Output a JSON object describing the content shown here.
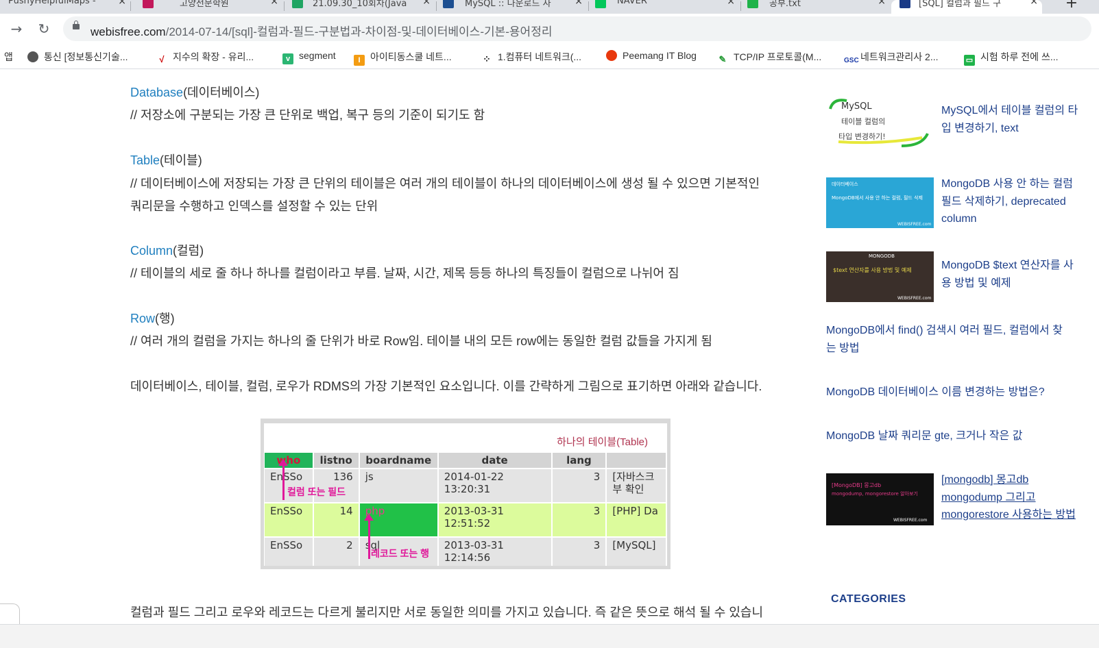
{
  "tabs": [
    {
      "label": "PushyHelpfulMaps - ",
      "close": "×"
    },
    {
      "label": "고양전문학원",
      "close": "×"
    },
    {
      "label": "21.09.30_10회차(Java",
      "close": "×"
    },
    {
      "label": "MySQL :: 다운로드 사",
      "close": "×"
    },
    {
      "label": "NAVER",
      "close": "×"
    },
    {
      "label": "공부.txt",
      "close": "×"
    },
    {
      "label": "[SQL] 컬럼과 필드 구",
      "close": "×"
    }
  ],
  "new_tab": "+",
  "nav": {
    "back": "→",
    "reload": "↻"
  },
  "url": {
    "host": "webisfree.com",
    "path": "/2014-07-14/[sql]-컬럼과-필드-구분법과-차이점-및-데이터베이스-기본-용어정리"
  },
  "bookmarks": [
    {
      "label": "앱",
      "icon": "apps-icon"
    },
    {
      "label": "통신 [정보통신기술...",
      "icon": "globe-icon"
    },
    {
      "label": "지수의 확장 - 유리...",
      "icon": "math-icon"
    },
    {
      "label": "segment",
      "icon": "v-icon"
    },
    {
      "label": "아이티동스쿨 네트...",
      "icon": "school-icon"
    },
    {
      "label": "1.컴퓨터 네트워크(...",
      "icon": "dots-icon"
    },
    {
      "label": "Peemang IT Blog",
      "icon": "blog-icon"
    },
    {
      "label": "TCP/IP 프로토콜(M...",
      "icon": "pen-icon"
    },
    {
      "label": "네트워크관리사 2...",
      "icon": "gsc-icon"
    },
    {
      "label": "시험 하루 전에 쓰...",
      "icon": "chat-icon"
    }
  ],
  "article": {
    "database": {
      "kw": "Database",
      "ko": "(데이터베이스)",
      "desc": "// 저장소에 구분되는 가장 큰 단위로 백업, 복구 등의 기준이 되기도 함"
    },
    "table": {
      "kw": "Table",
      "ko": "(테이블)",
      "desc1": "// 데이터베이스에 저장되는 가장 큰 단위의 테이블은 여러 개의 테이블이 하나의 데이터베이스에 생성 될 수 있으면 기본적인",
      "desc2": "쿼리문을 수행하고 인덱스를 설정할 수 있는 단위"
    },
    "column": {
      "kw": "Column",
      "ko": "(컬럼)",
      "desc": "// 테이블의 세로 줄 하나 하나를 컬럼이라고 부름. 날짜, 시간, 제목 등등 하나의 특징들이 컬럼으로 나뉘어 짐"
    },
    "row": {
      "kw": "Row",
      "ko": "(행)",
      "desc": "// 여러 개의 컬럼을 가지는 하나의 줄 단위가 바로 Row임. 테이블 내의 모든 row에는  동일한 컬럼 값들을 가지게 됨"
    },
    "summary": "데이터베이스, 테이블, 컬럼, 로우가 RDMS의 가장 기본적인 요소입니다. 이를 간략하게 그림으로 표기하면 아래와 같습니다.",
    "bottom": "컬럼과 필드 그리고 로우와 레코드는 다르게 불리지만 서로 동일한 의미를 가지고 있습니다. 즉 같은 뜻으로 해석 될 수 있습니"
  },
  "figure": {
    "title": "하나의 테이블(Table)",
    "headers": [
      "who",
      "listno",
      "boardname",
      "date",
      "lang",
      ""
    ],
    "rows": [
      [
        "EnSSo",
        "136",
        "js",
        "2014-01-22 13:20:31",
        "3",
        "[자바스크",
        "부 확인"
      ],
      [
        "EnSSo",
        "14",
        "php",
        "2013-03-31 12:51:52",
        "3",
        "[PHP] Da",
        ""
      ],
      [
        "EnSSo",
        "2",
        "sql",
        "2013-03-31 12:14:56",
        "3",
        "[MySQL]",
        ""
      ]
    ],
    "anno_column": "컬럼 또는 필드",
    "anno_record": "레코드 또는 행"
  },
  "sidebar": [
    {
      "line1": "MySQL에서 테이블 컬럼의 타",
      "line2": "입 변경하기, text",
      "line3": "",
      "thumb": "mysql"
    },
    {
      "line1": "MongoDB 사용 안 하는 컬럼",
      "line2": "필드 삭제하기, deprecated",
      "line3": "column",
      "thumb": "mongo-blue"
    },
    {
      "line1": "MongoDB $text 연산자를 사",
      "line2": "용 방법 및 예제",
      "line3": "",
      "thumb": "mongo-dark"
    },
    {
      "line1": "MongoDB에서 find() 검색시 여러 필드, 컬럼에서 찾",
      "line2": "는 방법",
      "line3": ""
    },
    {
      "line1": "MongoDB 데이터베이스 이름 변경하는 방법은?",
      "line2": "",
      "line3": ""
    },
    {
      "line1": "MongoDB 날짜 쿼리문 gte, 크거나 작은 값",
      "line2": "",
      "line3": ""
    },
    {
      "line1": "[mongodb] 몽고db",
      "line2": "mongodump 그리고",
      "line3": "mongorestore 사용하는 방법",
      "thumb": "mongo-black"
    }
  ],
  "thumb_text": {
    "mysql_1": "MySQL",
    "mysql_2": "테이블 컬럼의",
    "mysql_3": "타입 변경하기!",
    "blue_1": "데이터베이스",
    "blue_2": "MongoDB에서 사용 안 하는 컬럼, 필드 삭제",
    "blue_3": "WEBISFREE.com",
    "dark_1": "MONGODB",
    "dark_2": "$text 연산자를 사용 방법 및 예제",
    "dark_3": "WEBISFREE.com",
    "black_1": "[MongoDB] 몽고db",
    "black_2": "mongodump, mongorestore 알아보기",
    "black_3": "WEBISFREE.com"
  },
  "categories": "CATEGORIES"
}
